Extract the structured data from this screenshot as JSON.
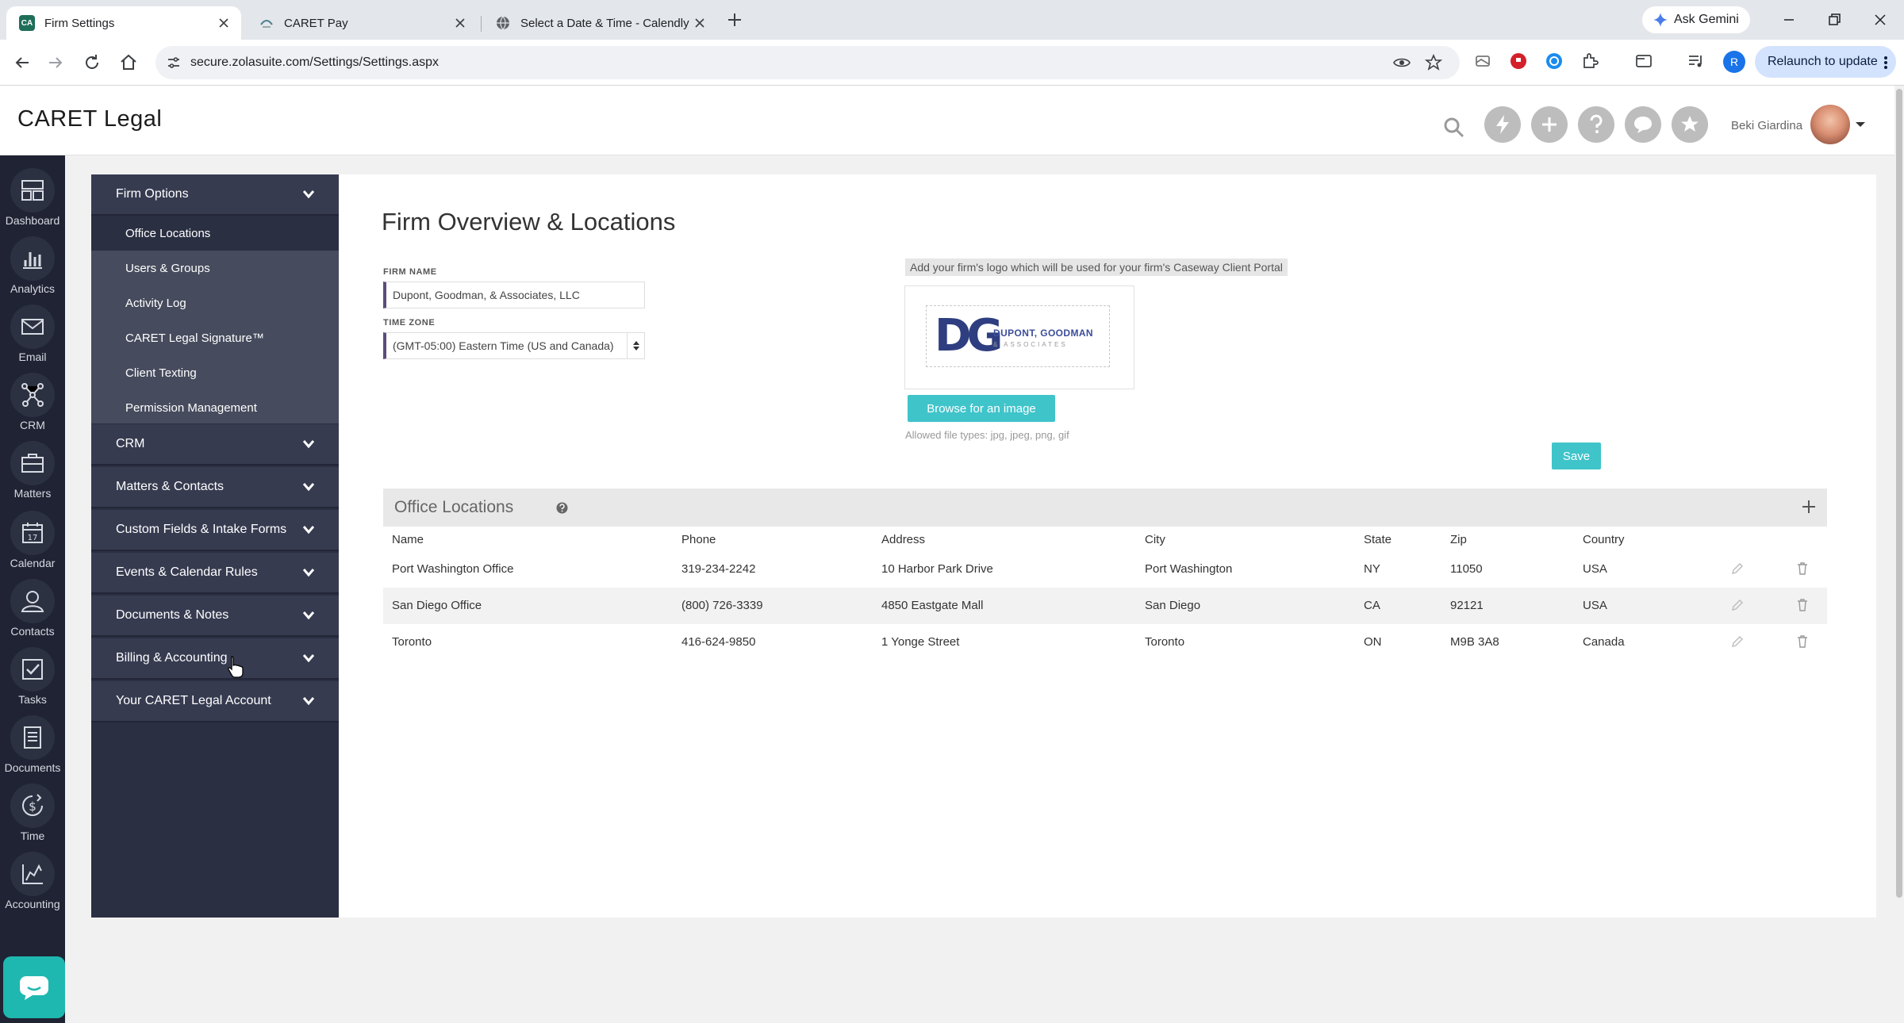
{
  "browser": {
    "tabs": [
      {
        "title": "Firm Settings",
        "favicon": "CA"
      },
      {
        "title": "CARET Pay"
      },
      {
        "title": "Select a Date & Time - Calendly"
      }
    ],
    "gemini_label": "Ask Gemini",
    "url": "secure.zolasuite.com/Settings/Settings.aspx",
    "profile_initial": "R",
    "relaunch_label": "Relaunch to update"
  },
  "app": {
    "logo": "CARET Legal",
    "user_name": "Beki Giardina"
  },
  "rail": [
    {
      "label": "Dashboard",
      "icon": "dashboard-icon"
    },
    {
      "label": "Analytics",
      "icon": "analytics-icon"
    },
    {
      "label": "Email",
      "icon": "email-icon"
    },
    {
      "label": "CRM",
      "icon": "crm-icon"
    },
    {
      "label": "Matters",
      "icon": "briefcase-icon"
    },
    {
      "label": "Calendar",
      "icon": "calendar-icon"
    },
    {
      "label": "Contacts",
      "icon": "contacts-icon"
    },
    {
      "label": "Tasks",
      "icon": "tasks-icon"
    },
    {
      "label": "Documents",
      "icon": "documents-icon"
    },
    {
      "label": "Time",
      "icon": "time-icon"
    },
    {
      "label": "Accounting",
      "icon": "accounting-icon"
    }
  ],
  "settings_nav": {
    "firm_options": "Firm Options",
    "firm_options_items": [
      "Office Locations",
      "Users & Groups",
      "Activity Log",
      "CARET Legal Signature™",
      "Client Texting",
      "Permission Management"
    ],
    "sections": [
      "CRM",
      "Matters & Contacts",
      "Custom Fields & Intake Forms",
      "Events & Calendar Rules",
      "Documents & Notes",
      "Billing & Accounting",
      "Your CARET Legal Account"
    ]
  },
  "overview": {
    "title": "Firm Overview & Locations",
    "firm_name_label": "FIRM NAME",
    "firm_name_value": "Dupont, Goodman, & Associates, LLC",
    "time_zone_label": "TIME ZONE",
    "time_zone_value": "(GMT-05:00) Eastern Time (US and Canada)",
    "logo_note": "Add your firm's logo which will be used for your firm's Caseway Client Portal",
    "logo_initials": "DG",
    "logo_name": "DUPONT, GOODMAN",
    "logo_sub": "& ASSOCIATES",
    "browse_label": "Browse for an image",
    "allowed_types": "Allowed file types: jpg, jpeg, png, gif",
    "save_label": "Save"
  },
  "office_locations": {
    "title": "Office Locations",
    "columns": [
      "Name",
      "Phone",
      "Address",
      "City",
      "State",
      "Zip",
      "Country"
    ],
    "rows": [
      [
        "Port Washington Office",
        "319-234-2242",
        "10 Harbor Park Drive",
        "Port Washington",
        "NY",
        "11050",
        "USA"
      ],
      [
        "San Diego Office",
        "(800) 726-3339",
        "4850 Eastgate Mall",
        "San Diego",
        "CA",
        "92121",
        "USA"
      ],
      [
        "Toronto",
        "416-624-9850",
        "1 Yonge Street",
        "Toronto",
        "ON",
        "M9B 3A8",
        "Canada"
      ]
    ]
  },
  "colors": {
    "accent": "#3fc4ca",
    "rail_bg": "#1f2333",
    "nav_bg": "#2b2f42",
    "input_border": "#5a4d7a"
  }
}
